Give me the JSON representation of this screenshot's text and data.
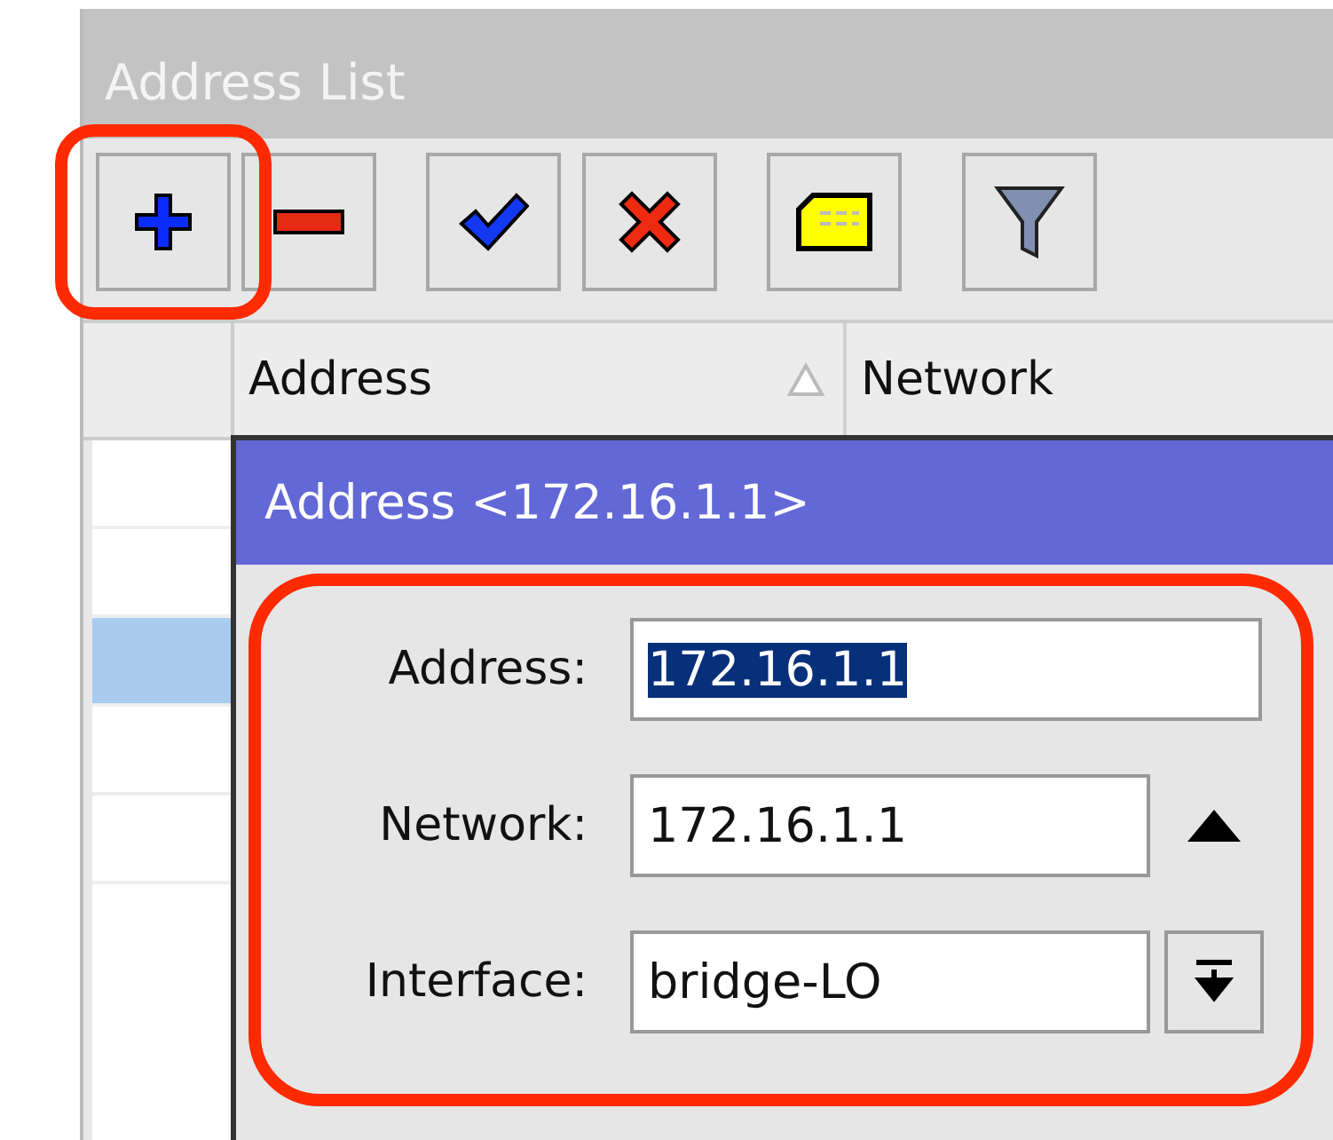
{
  "window": {
    "title": "Address List"
  },
  "toolbar": [
    {
      "kind": "add",
      "highlighted": true
    },
    {
      "kind": "remove",
      "highlighted": false
    },
    {
      "kind": "enable",
      "highlighted": false
    },
    {
      "kind": "disable",
      "highlighted": false
    },
    {
      "kind": "comment",
      "highlighted": false
    },
    {
      "kind": "filter",
      "highlighted": false
    }
  ],
  "table": {
    "columns": [
      {
        "label": "Address",
        "sorted": true
      },
      {
        "label": "Network",
        "sorted": false
      }
    ],
    "rows": [
      {
        "selected": false
      },
      {
        "selected": false
      },
      {
        "selected": true
      },
      {
        "selected": false
      },
      {
        "selected": false
      }
    ]
  },
  "dialog": {
    "title": "Address <172.16.1.1>",
    "highlighted": true,
    "fields": [
      {
        "label": "Address:",
        "value": "172.16.1.1",
        "kind": "text",
        "text_selected": true
      },
      {
        "label": "Network:",
        "value": "172.16.1.1",
        "kind": "toggle",
        "text_selected": false
      },
      {
        "label": "Interface:",
        "value": "bridge-LO",
        "kind": "dropdown",
        "text_selected": false
      }
    ]
  }
}
